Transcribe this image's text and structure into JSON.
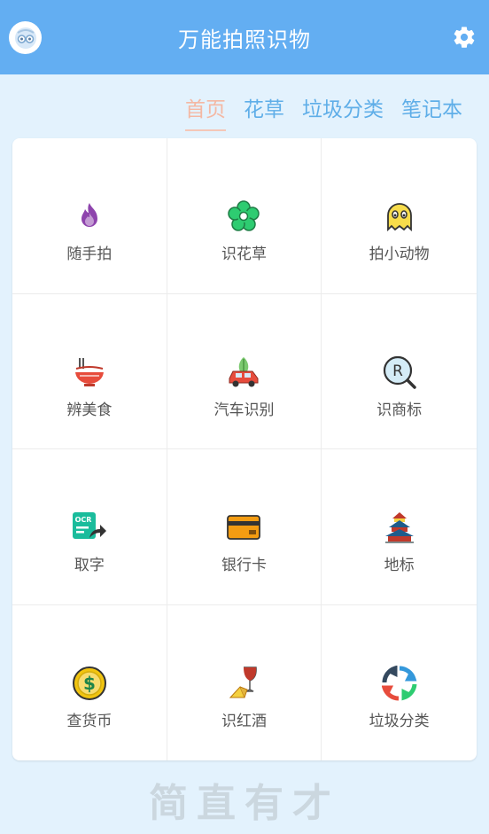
{
  "header": {
    "title": "万能拍照识物",
    "avatar_icon": "face-avatar-icon",
    "settings_icon": "gear-icon"
  },
  "tabs": [
    {
      "label": "首页",
      "active": true
    },
    {
      "label": "花草",
      "active": false
    },
    {
      "label": "垃圾分类",
      "active": false
    },
    {
      "label": "笔记本",
      "active": false
    }
  ],
  "grid": [
    {
      "label": "随手拍",
      "icon": "fire-icon"
    },
    {
      "label": "识花草",
      "icon": "flower-icon"
    },
    {
      "label": "拍小动物",
      "icon": "ghost-animal-icon"
    },
    {
      "label": "辨美食",
      "icon": "noodle-bowl-icon"
    },
    {
      "label": "汽车识别",
      "icon": "car-icon"
    },
    {
      "label": "识商标",
      "icon": "trademark-search-icon"
    },
    {
      "label": "取字",
      "icon": "ocr-icon"
    },
    {
      "label": "银行卡",
      "icon": "bank-card-icon"
    },
    {
      "label": "地标",
      "icon": "landmark-temple-icon"
    },
    {
      "label": "查货币",
      "icon": "coin-dollar-icon"
    },
    {
      "label": "识红酒",
      "icon": "wine-glass-icon"
    },
    {
      "label": "垃圾分类",
      "icon": "recycle-icon"
    }
  ],
  "footer": {
    "watermark": "简直有才"
  },
  "colors": {
    "appbar": "#63aef2",
    "background": "#e3f2fd",
    "tab": "#5faee8",
    "tab_active": "#f4b8a3"
  }
}
